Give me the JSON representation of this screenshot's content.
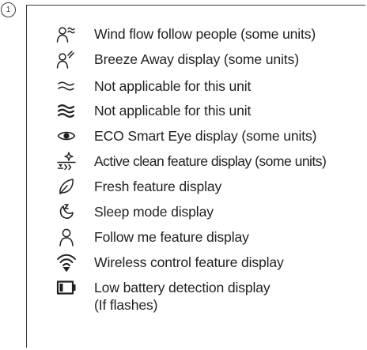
{
  "callout_number": "1",
  "legend_items": [
    {
      "icon": "wind-flow-follow-people-icon",
      "text": "Wind flow follow people (some units)"
    },
    {
      "icon": "breeze-away-icon",
      "text": "Breeze Away display (some units)"
    },
    {
      "icon": "double-wave-icon",
      "text": "Not applicable for this unit"
    },
    {
      "icon": "triple-wave-icon",
      "text": "Not applicable for this unit"
    },
    {
      "icon": "eco-eye-icon",
      "text": "ECO Smart Eye display (some units)"
    },
    {
      "icon": "active-clean-icon",
      "text": "Active clean feature display (some units)"
    },
    {
      "icon": "leaf-icon",
      "text": "Fresh feature display"
    },
    {
      "icon": "sleep-moon-icon",
      "text": "Sleep mode display"
    },
    {
      "icon": "person-icon",
      "text": "Follow me feature display"
    },
    {
      "icon": "wireless-icon",
      "text": "Wireless control feature display"
    },
    {
      "icon": "battery-icon",
      "text": "Low battery detection display",
      "text_line2": "(If flashes)"
    }
  ]
}
